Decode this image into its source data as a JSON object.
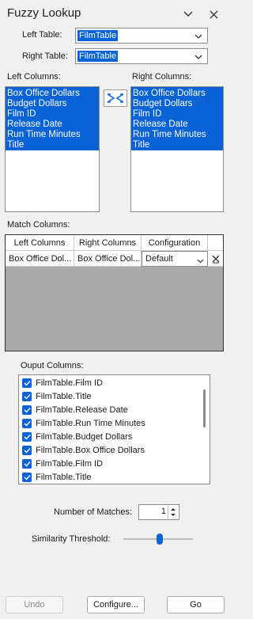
{
  "pane": {
    "title": "Fuzzy Lookup"
  },
  "tables": {
    "left_label": "Left Table:",
    "left_value": "FilmTable",
    "right_label": "Right Table:",
    "right_value": "FilmTable"
  },
  "columns": {
    "left_label": "Left Columns:",
    "right_label": "Right Columns:",
    "left_items": [
      "Box Office Dollars",
      "Budget Dollars",
      "Film ID",
      "Release Date",
      "Run Time Minutes",
      "Title"
    ],
    "right_items": [
      "Box Office Dollars",
      "Budget Dollars",
      "Film ID",
      "Release Date",
      "Run Time Minutes",
      "Title"
    ]
  },
  "match": {
    "label": "Match Columns:",
    "headers": [
      "Left Columns",
      "Right Columns",
      "Configuration"
    ],
    "rows": [
      {
        "left": "Box Office Dol...",
        "right": "Box Office Dol...",
        "config": "Default"
      }
    ]
  },
  "output": {
    "label": "Ouput Columns:",
    "items": [
      "FilmTable.Film ID",
      "FilmTable.Title",
      "FilmTable.Release Date",
      "FilmTable.Run Time Minutes",
      "FilmTable.Budget Dollars",
      "FilmTable.Box Office Dollars",
      "FilmTable.Film ID",
      "FilmTable.Title"
    ]
  },
  "options": {
    "matches_label": "Number of Matches:",
    "matches_value": "1",
    "threshold_label": "Similarity Threshold:",
    "threshold_fraction": 0.52
  },
  "buttons": {
    "undo": "Undo",
    "configure": "Configure...",
    "go": "Go"
  },
  "colors": {
    "accent": "#0a63d6",
    "grid_bg": "#a9a9a9",
    "pane_bg": "#f0f0f0"
  }
}
